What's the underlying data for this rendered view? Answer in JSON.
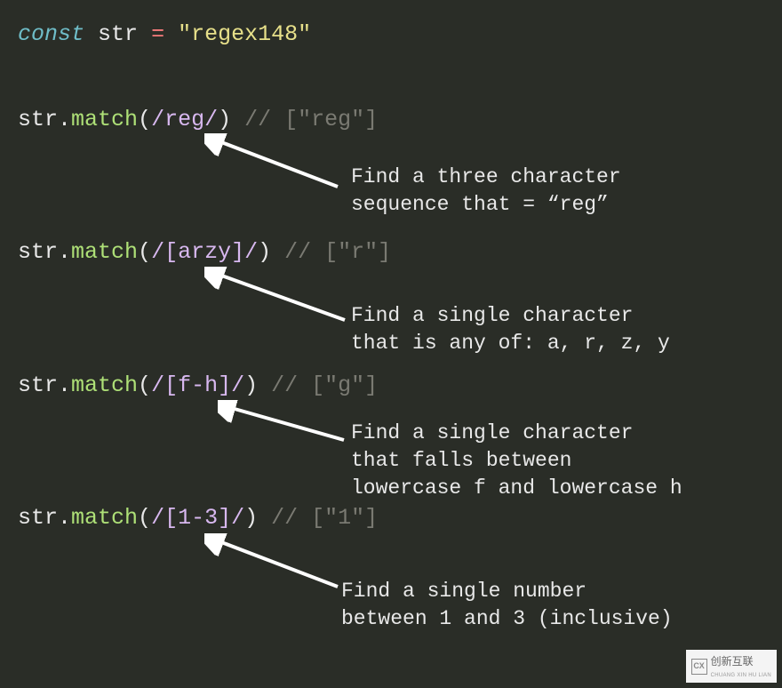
{
  "code": {
    "decl": {
      "keyword": "const",
      "name": "str",
      "op": "=",
      "value": "\"regex148\""
    },
    "lines": [
      {
        "obj": "str",
        "dot": ".",
        "method": "match",
        "open": "(",
        "regex": "/reg/",
        "close": ")",
        "comment": " // [\"reg\"]"
      },
      {
        "obj": "str",
        "dot": ".",
        "method": "match",
        "open": "(",
        "regex": "/[arzy]/",
        "close": ")",
        "comment": " // [\"r\"]"
      },
      {
        "obj": "str",
        "dot": ".",
        "method": "match",
        "open": "(",
        "regex": "/[f-h]/",
        "close": ")",
        "comment": " // [\"g\"]"
      },
      {
        "obj": "str",
        "dot": ".",
        "method": "match",
        "open": "(",
        "regex": "/[1-3]/",
        "close": ")",
        "comment": " // [\"1\"]"
      }
    ]
  },
  "annotations": [
    "Find a three character\nsequence that = “reg”",
    "Find a single character\nthat is any of: a, r, z, y",
    "Find a single character\nthat falls between\nlowercase f and lowercase h",
    "Find a single number\nbetween 1 and 3 (inclusive)"
  ],
  "watermark": {
    "logo": "CX",
    "text": "创新互联",
    "sub": "CHUANG XIN HU LIAN"
  }
}
